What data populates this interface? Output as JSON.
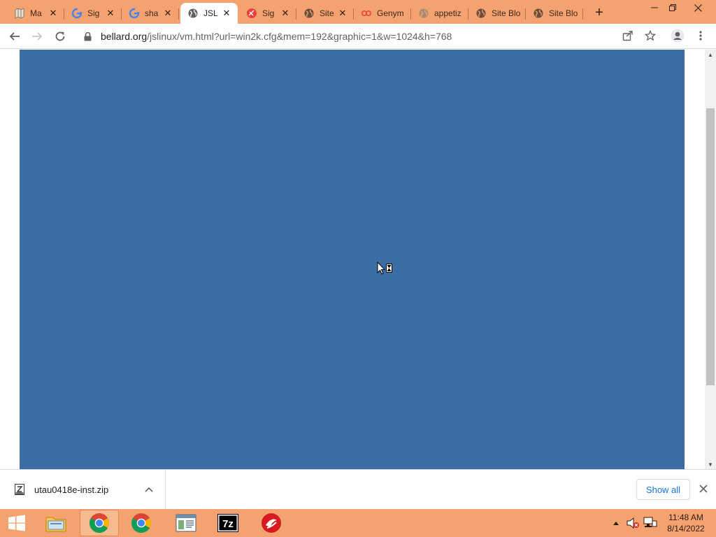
{
  "tabs": [
    {
      "title": "Ma",
      "icon": "maps-icon",
      "active": false
    },
    {
      "title": "Sig",
      "icon": "google-icon",
      "active": false
    },
    {
      "title": "sha",
      "icon": "google-icon",
      "active": false
    },
    {
      "title": "JSLi",
      "icon": "globe-icon",
      "active": true
    },
    {
      "title": "Sig",
      "icon": "app-icon",
      "active": false
    },
    {
      "title": "Site",
      "icon": "globe-icon",
      "active": false
    },
    {
      "title": "Genym",
      "icon": "genymotion-icon",
      "active": false
    },
    {
      "title": "appetiz",
      "icon": "globe-icon",
      "active": false
    },
    {
      "title": "Site Blo",
      "icon": "globe-icon",
      "active": false
    },
    {
      "title": "Site Blo",
      "icon": "globe-icon",
      "active": false
    }
  ],
  "address": {
    "host": "bellard.org",
    "path": "/jslinux/vm.html?url=win2k.cfg&mem=192&graphic=1&w=1024&h=768"
  },
  "download": {
    "filename": "utau0418e-inst.zip",
    "show_all_label": "Show all"
  },
  "taskbar": {
    "apps": [
      "chrome-icon",
      "chrome-icon",
      "notepad-icon",
      "7zip-icon",
      "trend-micro-icon"
    ]
  },
  "clock": {
    "time": "11:48 AM",
    "date": "8/14/2022"
  },
  "colors": {
    "tabstrip": "#f4a26f",
    "vm_background": "#3c6ea5",
    "taskbar": "#f4a26f",
    "link": "#1a73e8"
  }
}
